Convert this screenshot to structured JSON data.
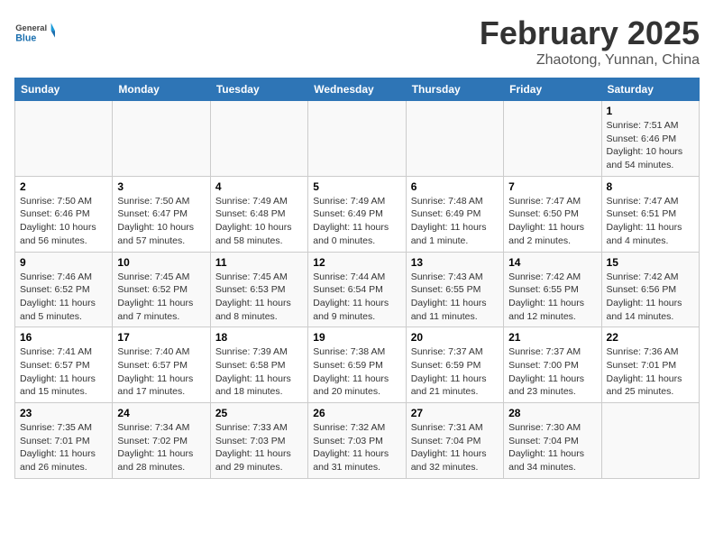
{
  "header": {
    "logo_general": "General",
    "logo_blue": "Blue",
    "month_title": "February 2025",
    "subtitle": "Zhaotong, Yunnan, China"
  },
  "days_of_week": [
    "Sunday",
    "Monday",
    "Tuesday",
    "Wednesday",
    "Thursday",
    "Friday",
    "Saturday"
  ],
  "weeks": [
    [
      {
        "day": "",
        "info": ""
      },
      {
        "day": "",
        "info": ""
      },
      {
        "day": "",
        "info": ""
      },
      {
        "day": "",
        "info": ""
      },
      {
        "day": "",
        "info": ""
      },
      {
        "day": "",
        "info": ""
      },
      {
        "day": "1",
        "info": "Sunrise: 7:51 AM\nSunset: 6:46 PM\nDaylight: 10 hours and 54 minutes."
      }
    ],
    [
      {
        "day": "2",
        "info": "Sunrise: 7:50 AM\nSunset: 6:46 PM\nDaylight: 10 hours and 56 minutes."
      },
      {
        "day": "3",
        "info": "Sunrise: 7:50 AM\nSunset: 6:47 PM\nDaylight: 10 hours and 57 minutes."
      },
      {
        "day": "4",
        "info": "Sunrise: 7:49 AM\nSunset: 6:48 PM\nDaylight: 10 hours and 58 minutes."
      },
      {
        "day": "5",
        "info": "Sunrise: 7:49 AM\nSunset: 6:49 PM\nDaylight: 11 hours and 0 minutes."
      },
      {
        "day": "6",
        "info": "Sunrise: 7:48 AM\nSunset: 6:49 PM\nDaylight: 11 hours and 1 minute."
      },
      {
        "day": "7",
        "info": "Sunrise: 7:47 AM\nSunset: 6:50 PM\nDaylight: 11 hours and 2 minutes."
      },
      {
        "day": "8",
        "info": "Sunrise: 7:47 AM\nSunset: 6:51 PM\nDaylight: 11 hours and 4 minutes."
      }
    ],
    [
      {
        "day": "9",
        "info": "Sunrise: 7:46 AM\nSunset: 6:52 PM\nDaylight: 11 hours and 5 minutes."
      },
      {
        "day": "10",
        "info": "Sunrise: 7:45 AM\nSunset: 6:52 PM\nDaylight: 11 hours and 7 minutes."
      },
      {
        "day": "11",
        "info": "Sunrise: 7:45 AM\nSunset: 6:53 PM\nDaylight: 11 hours and 8 minutes."
      },
      {
        "day": "12",
        "info": "Sunrise: 7:44 AM\nSunset: 6:54 PM\nDaylight: 11 hours and 9 minutes."
      },
      {
        "day": "13",
        "info": "Sunrise: 7:43 AM\nSunset: 6:55 PM\nDaylight: 11 hours and 11 minutes."
      },
      {
        "day": "14",
        "info": "Sunrise: 7:42 AM\nSunset: 6:55 PM\nDaylight: 11 hours and 12 minutes."
      },
      {
        "day": "15",
        "info": "Sunrise: 7:42 AM\nSunset: 6:56 PM\nDaylight: 11 hours and 14 minutes."
      }
    ],
    [
      {
        "day": "16",
        "info": "Sunrise: 7:41 AM\nSunset: 6:57 PM\nDaylight: 11 hours and 15 minutes."
      },
      {
        "day": "17",
        "info": "Sunrise: 7:40 AM\nSunset: 6:57 PM\nDaylight: 11 hours and 17 minutes."
      },
      {
        "day": "18",
        "info": "Sunrise: 7:39 AM\nSunset: 6:58 PM\nDaylight: 11 hours and 18 minutes."
      },
      {
        "day": "19",
        "info": "Sunrise: 7:38 AM\nSunset: 6:59 PM\nDaylight: 11 hours and 20 minutes."
      },
      {
        "day": "20",
        "info": "Sunrise: 7:37 AM\nSunset: 6:59 PM\nDaylight: 11 hours and 21 minutes."
      },
      {
        "day": "21",
        "info": "Sunrise: 7:37 AM\nSunset: 7:00 PM\nDaylight: 11 hours and 23 minutes."
      },
      {
        "day": "22",
        "info": "Sunrise: 7:36 AM\nSunset: 7:01 PM\nDaylight: 11 hours and 25 minutes."
      }
    ],
    [
      {
        "day": "23",
        "info": "Sunrise: 7:35 AM\nSunset: 7:01 PM\nDaylight: 11 hours and 26 minutes."
      },
      {
        "day": "24",
        "info": "Sunrise: 7:34 AM\nSunset: 7:02 PM\nDaylight: 11 hours and 28 minutes."
      },
      {
        "day": "25",
        "info": "Sunrise: 7:33 AM\nSunset: 7:03 PM\nDaylight: 11 hours and 29 minutes."
      },
      {
        "day": "26",
        "info": "Sunrise: 7:32 AM\nSunset: 7:03 PM\nDaylight: 11 hours and 31 minutes."
      },
      {
        "day": "27",
        "info": "Sunrise: 7:31 AM\nSunset: 7:04 PM\nDaylight: 11 hours and 32 minutes."
      },
      {
        "day": "28",
        "info": "Sunrise: 7:30 AM\nSunset: 7:04 PM\nDaylight: 11 hours and 34 minutes."
      },
      {
        "day": "",
        "info": ""
      }
    ]
  ]
}
